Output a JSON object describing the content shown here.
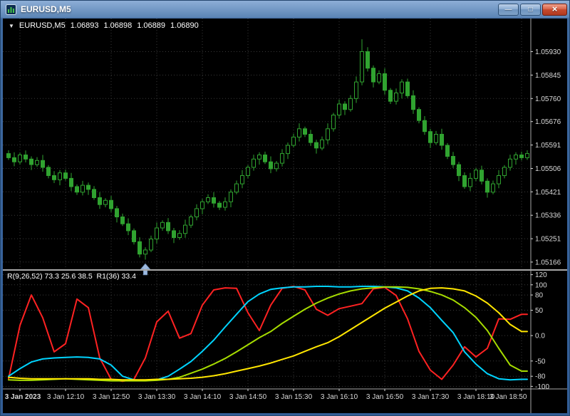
{
  "window": {
    "title": "EURUSD,M5",
    "icons": {
      "minimize": "—",
      "restore": "□",
      "close": "×"
    }
  },
  "chart_header": {
    "dropdown": "▼",
    "symbol": "EURUSD,M5",
    "open": "1.06893",
    "high": "1.06898",
    "low": "1.06889",
    "close": "1.06890"
  },
  "indicator_header": {
    "label": "R(9,26,52) 73.3 25.6 38.5  R1(36) 33.4"
  },
  "colors": {
    "background": "#000000",
    "grid": "#3a3a3a",
    "candle": "#30a330",
    "separator": "#a8a8a8",
    "axis_text": "#dadada",
    "arrow": "#9cb8de",
    "arrow_stroke": "#6e8fb8"
  },
  "chart_data": [
    {
      "type": "candlestick",
      "symbol": "EURUSD",
      "timeframe": "M5",
      "y_range": [
        1.0514,
        1.0604
      ],
      "price_axis": {
        "labels": [
          "1.05930",
          "1.05845",
          "1.05760",
          "1.05676",
          "1.05591",
          "1.05506",
          "1.05421",
          "1.05336",
          "1.05251",
          "1.05166"
        ],
        "values": [
          1.0593,
          1.05845,
          1.0576,
          1.05676,
          1.05591,
          1.05506,
          1.05421,
          1.05336,
          1.05251,
          1.05166
        ]
      },
      "time_axis": {
        "labels": [
          "3 Jan 2023",
          "3 Jan 12:10",
          "3 Jan 12:50",
          "3 Jan 13:30",
          "3 Jan 14:10",
          "3 Jan 14:50",
          "3 Jan 15:30",
          "3 Jan 16:10",
          "3 Jan 16:50",
          "3 Jan 17:30",
          "3 Jan 18:10",
          "3 Jan 18:50"
        ],
        "candle_indices": [
          2,
          10,
          18,
          26,
          34,
          42,
          50,
          58,
          66,
          74,
          82,
          90
        ]
      },
      "candles": [
        [
          1.0556,
          1.05572,
          1.05537,
          1.05545
        ],
        [
          1.05545,
          1.05565,
          1.05514,
          1.0553
        ],
        [
          1.0553,
          1.05563,
          1.0552,
          1.05555
        ],
        [
          1.05555,
          1.05571,
          1.05528,
          1.0554
        ],
        [
          1.0554,
          1.0555,
          1.055,
          1.0552
        ],
        [
          1.0552,
          1.05547,
          1.05512,
          1.05535
        ],
        [
          1.05535,
          1.05555,
          1.05494,
          1.0551
        ],
        [
          1.0551,
          1.05518,
          1.0547,
          1.0548
        ],
        [
          1.0548,
          1.05496,
          1.05453,
          1.05465
        ],
        [
          1.05465,
          1.055,
          1.05445,
          1.0549
        ],
        [
          1.0549,
          1.05502,
          1.05462,
          1.0547
        ],
        [
          1.0547,
          1.0549,
          1.05424,
          1.0544
        ],
        [
          1.0544,
          1.05448,
          1.0541,
          1.0542
        ],
        [
          1.0542,
          1.05461,
          1.05408,
          1.05445
        ],
        [
          1.05445,
          1.05455,
          1.0541,
          1.0543
        ],
        [
          1.0543,
          1.05442,
          1.05392,
          1.054
        ],
        [
          1.054,
          1.0542,
          1.05359,
          1.05375
        ],
        [
          1.05375,
          1.05398,
          1.05365,
          1.0539
        ],
        [
          1.0539,
          1.05406,
          1.05348,
          1.0536
        ],
        [
          1.0536,
          1.0537,
          1.0531,
          1.0533
        ],
        [
          1.0533,
          1.05342,
          1.05297,
          1.05305
        ],
        [
          1.05305,
          1.05325,
          1.05264,
          1.0528
        ],
        [
          1.0528,
          1.05288,
          1.0523,
          1.0524
        ],
        [
          1.0524,
          1.05256,
          1.05183,
          1.05195
        ],
        [
          1.05195,
          1.0522,
          1.05175,
          1.0521
        ],
        [
          1.0521,
          1.05262,
          1.05202,
          1.0525
        ],
        [
          1.0525,
          1.0531,
          1.05234,
          1.0529
        ],
        [
          1.0529,
          1.05318,
          1.0528,
          1.0531
        ],
        [
          1.0531,
          1.05326,
          1.05268,
          1.0528
        ],
        [
          1.0528,
          1.0529,
          1.05235,
          1.05255
        ],
        [
          1.05255,
          1.05282,
          1.05247,
          1.0527
        ],
        [
          1.0527,
          1.0532,
          1.05254,
          1.053
        ],
        [
          1.053,
          1.05338,
          1.0529,
          1.0533
        ],
        [
          1.0533,
          1.05376,
          1.05318,
          1.0536
        ],
        [
          1.0536,
          1.05395,
          1.0534,
          1.05385
        ],
        [
          1.05385,
          1.05412,
          1.05377,
          1.054
        ],
        [
          1.054,
          1.0542,
          1.05364,
          1.0538
        ],
        [
          1.0538,
          1.05388,
          1.05355,
          1.05365
        ],
        [
          1.05365,
          1.05401,
          1.05353,
          1.05385
        ],
        [
          1.05385,
          1.0543,
          1.05365,
          1.0542
        ],
        [
          1.0542,
          1.05462,
          1.05412,
          1.0545
        ],
        [
          1.0545,
          1.055,
          1.05434,
          1.0548
        ],
        [
          1.0548,
          1.05518,
          1.0547,
          1.0551
        ],
        [
          1.0551,
          1.05556,
          1.05498,
          1.0554
        ],
        [
          1.0554,
          1.05565,
          1.0552,
          1.05555
        ],
        [
          1.05555,
          1.05567,
          1.05522,
          1.0553
        ],
        [
          1.0553,
          1.0555,
          1.05489,
          1.05505
        ],
        [
          1.05505,
          1.05533,
          1.05495,
          1.05525
        ],
        [
          1.05525,
          1.05576,
          1.05513,
          1.0556
        ],
        [
          1.0556,
          1.056,
          1.0554,
          1.0559
        ],
        [
          1.0559,
          1.05632,
          1.05582,
          1.0562
        ],
        [
          1.0562,
          1.0567,
          1.05604,
          1.0565
        ],
        [
          1.0565,
          1.05658,
          1.0562,
          1.0563
        ],
        [
          1.0563,
          1.05646,
          1.05588,
          1.056
        ],
        [
          1.056,
          1.0561,
          1.0556,
          1.0558
        ],
        [
          1.0558,
          1.05622,
          1.05572,
          1.0561
        ],
        [
          1.0561,
          1.0567,
          1.05594,
          1.0565
        ],
        [
          1.0565,
          1.05708,
          1.0564,
          1.057
        ],
        [
          1.057,
          1.05756,
          1.05688,
          1.0574
        ],
        [
          1.0574,
          1.0575,
          1.057,
          1.0572
        ],
        [
          1.0572,
          1.05772,
          1.05712,
          1.0576
        ],
        [
          1.0576,
          1.0584,
          1.05744,
          1.0582
        ],
        [
          1.0582,
          1.05975,
          1.05808,
          1.0593
        ],
        [
          1.0593,
          1.05946,
          1.05858,
          1.0587
        ],
        [
          1.0587,
          1.0588,
          1.058,
          1.0582
        ],
        [
          1.0582,
          1.05862,
          1.05812,
          1.0585
        ],
        [
          1.0585,
          1.0587,
          1.05774,
          1.0579
        ],
        [
          1.0579,
          1.05798,
          1.0574,
          1.0575
        ],
        [
          1.0575,
          1.05796,
          1.05738,
          1.0578
        ],
        [
          1.0578,
          1.0583,
          1.0576,
          1.0582
        ],
        [
          1.0582,
          1.05832,
          1.05762,
          1.0577
        ],
        [
          1.0577,
          1.0579,
          1.05704,
          1.0572
        ],
        [
          1.0572,
          1.05728,
          1.0567,
          1.0568
        ],
        [
          1.0568,
          1.05696,
          1.05628,
          1.0564
        ],
        [
          1.0564,
          1.0565,
          1.0558,
          1.056
        ],
        [
          1.056,
          1.05642,
          1.05592,
          1.0563
        ],
        [
          1.0563,
          1.0565,
          1.05574,
          1.0559
        ],
        [
          1.0559,
          1.05598,
          1.0554,
          1.0555
        ],
        [
          1.0555,
          1.05566,
          1.05508,
          1.0552
        ],
        [
          1.0552,
          1.0553,
          1.0546,
          1.0548
        ],
        [
          1.0548,
          1.05492,
          1.05432,
          1.0544
        ],
        [
          1.0544,
          1.0549,
          1.05424,
          1.0547
        ],
        [
          1.0547,
          1.05508,
          1.0546,
          1.055
        ],
        [
          1.055,
          1.05516,
          1.05448,
          1.0546
        ],
        [
          1.0546,
          1.0547,
          1.054,
          1.0542
        ],
        [
          1.0542,
          1.05462,
          1.05412,
          1.0545
        ],
        [
          1.0545,
          1.055,
          1.05434,
          1.0548
        ],
        [
          1.0548,
          1.05518,
          1.0547,
          1.0551
        ],
        [
          1.0551,
          1.05556,
          1.05498,
          1.0554
        ],
        [
          1.0554,
          1.05565,
          1.0552,
          1.05555
        ],
        [
          1.05555,
          1.05567,
          1.05535,
          1.05545
        ],
        [
          1.05545,
          1.05572,
          1.05537,
          1.0556
        ]
      ],
      "annotations": [
        {
          "type": "arrow-up",
          "candle_index": 24,
          "price": 1.0516
        }
      ]
    },
    {
      "type": "line",
      "title": "R(9,26,52) 73.3 25.6 38.5  R1(36) 33.4",
      "y_range": [
        -105,
        125
      ],
      "axis": {
        "labels": [
          "120",
          "100",
          "80",
          "50",
          "0.0",
          "-50",
          "-80",
          "-100"
        ],
        "values": [
          120,
          100,
          80,
          50,
          0,
          -50,
          -80,
          -100
        ]
      },
      "x_step_candles": 2,
      "series": [
        {
          "key": "r9",
          "name": "R(9)",
          "color": "#ff2222",
          "values": [
            -85,
            20,
            80,
            35,
            -32,
            -16,
            72,
            55,
            -44,
            -86,
            -90,
            -86,
            -44,
            27,
            48,
            -5,
            4,
            60,
            90,
            94,
            93,
            45,
            10,
            60,
            93,
            97,
            90,
            52,
            40,
            53,
            58,
            63,
            92,
            95,
            79,
            33,
            -31,
            -68,
            -86,
            -58,
            -22,
            -42,
            -25,
            33,
            32,
            42
          ]
        },
        {
          "key": "r26",
          "name": "R(26)",
          "color": "#00d4ff",
          "values": [
            -80,
            -65,
            -52,
            -46,
            -44,
            -43,
            -42,
            -43,
            -46,
            -58,
            -80,
            -87,
            -88,
            -87,
            -80,
            -66,
            -51,
            -31,
            -9,
            17,
            42,
            67,
            82,
            91,
            94,
            96,
            96,
            97,
            97,
            96,
            96,
            97,
            97,
            96,
            94,
            88,
            74,
            55,
            30,
            6,
            -32,
            -56,
            -75,
            -85,
            -87,
            -86
          ]
        },
        {
          "key": "r52",
          "name": "R(52)",
          "color": "#a6dc00",
          "values": [
            -87,
            -88,
            -88,
            -87,
            -86,
            -85,
            -86,
            -87,
            -88,
            -89,
            -89,
            -89,
            -89,
            -88,
            -86,
            -82,
            -74,
            -66,
            -56,
            -45,
            -32,
            -18,
            -4,
            8,
            24,
            38,
            52,
            64,
            74,
            82,
            88,
            92,
            94,
            96,
            96,
            95,
            92,
            87,
            80,
            70,
            55,
            36,
            10,
            -25,
            -58,
            -70
          ]
        },
        {
          "key": "r1-36",
          "name": "R1(36)",
          "color": "#ffe600",
          "values": [
            -82,
            -84,
            -85,
            -85,
            -85,
            -85,
            -85,
            -85,
            -86,
            -86,
            -87,
            -87,
            -87,
            -86,
            -86,
            -85,
            -84,
            -82,
            -79,
            -75,
            -70,
            -65,
            -60,
            -54,
            -47,
            -40,
            -31,
            -22,
            -14,
            -2,
            12,
            26,
            40,
            54,
            66,
            78,
            88,
            93,
            94,
            92,
            88,
            78,
            64,
            45,
            22,
            8
          ]
        }
      ]
    }
  ]
}
